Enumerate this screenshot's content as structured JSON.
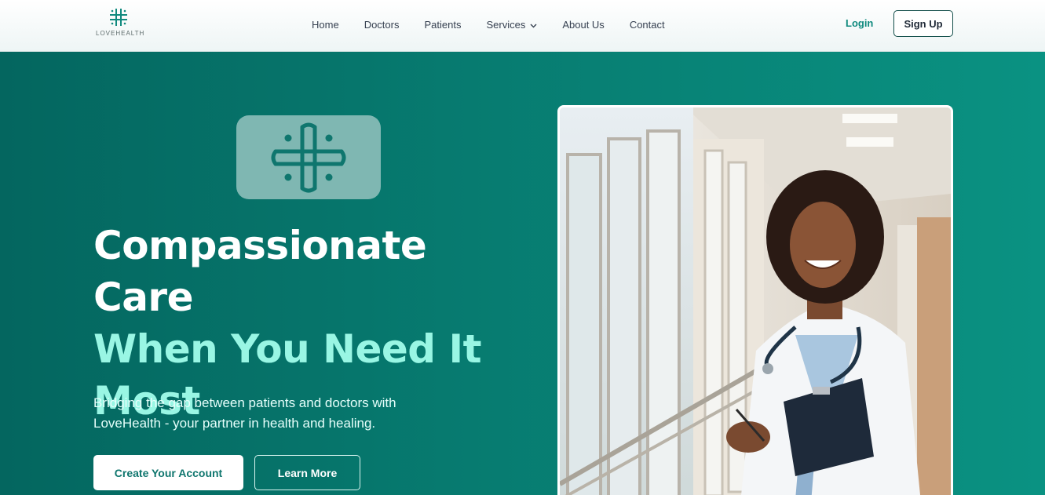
{
  "brand": {
    "name": "LOVEHEALTH"
  },
  "nav": {
    "items": [
      {
        "label": "Home"
      },
      {
        "label": "Doctors"
      },
      {
        "label": "Patients"
      },
      {
        "label": "Services",
        "has_dropdown": true
      },
      {
        "label": "About Us"
      },
      {
        "label": "Contact"
      }
    ]
  },
  "auth": {
    "login_label": "Login",
    "signup_label": "Sign Up"
  },
  "hero": {
    "title_line1": "Compassionate Care",
    "title_line2": "When You Need It",
    "title_line3": "Most",
    "description": "Bridging the gap between patients and doctors with LoveHealth - your partner in health and healing.",
    "primary_cta": "Create Your Account",
    "secondary_cta": "Learn More"
  },
  "icons": {
    "logo": "medical-cross-icon",
    "dropdown": "chevron-down-icon"
  },
  "colors": {
    "brand": "#0f766e",
    "accent": "#99f6e4",
    "login_text": "#0f8a7e"
  }
}
